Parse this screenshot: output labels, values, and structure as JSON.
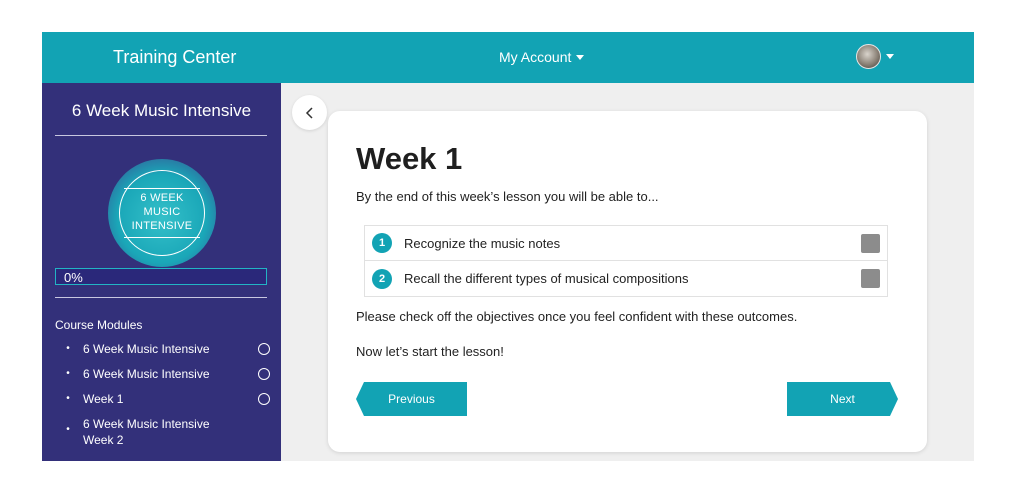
{
  "header": {
    "brand": "Training Center",
    "account_label": "My Account",
    "avatar_icon": "user-avatar",
    "colors": {
      "accent": "#12a3b4",
      "sidebar": "#33307a"
    }
  },
  "sidebar": {
    "course_title": "6 Week Music Intensive",
    "badge_lines": [
      "6 WEEK",
      "MUSIC",
      "INTENSIVE"
    ],
    "progress_text": "0%",
    "progress_fraction": 0,
    "modules_heading": "Course Modules",
    "modules": [
      {
        "label": "6 Week Music Intensive",
        "complete": false,
        "show_status": true
      },
      {
        "label": "6 Week Music Intensive",
        "complete": false,
        "show_status": true
      },
      {
        "label": "Week 1",
        "complete": false,
        "show_status": true
      },
      {
        "label": "6 Week Music Intensive Week 2",
        "complete": false,
        "show_status": false
      }
    ]
  },
  "main": {
    "back_icon": "chevron-left-icon",
    "week_title": "Week 1",
    "intro": "By the end of this week’s lesson you will be able to...",
    "objectives": [
      {
        "number": "1",
        "text": "Recognize the music notes",
        "checked": false
      },
      {
        "number": "2",
        "text": "Recall the different types of musical compositions",
        "checked": false
      }
    ],
    "note_check": "Please check off the objectives once you feel confident with these outcomes.",
    "note_start": "Now let’s start the lesson!",
    "previous_label": "Previous",
    "next_label": "Next"
  }
}
